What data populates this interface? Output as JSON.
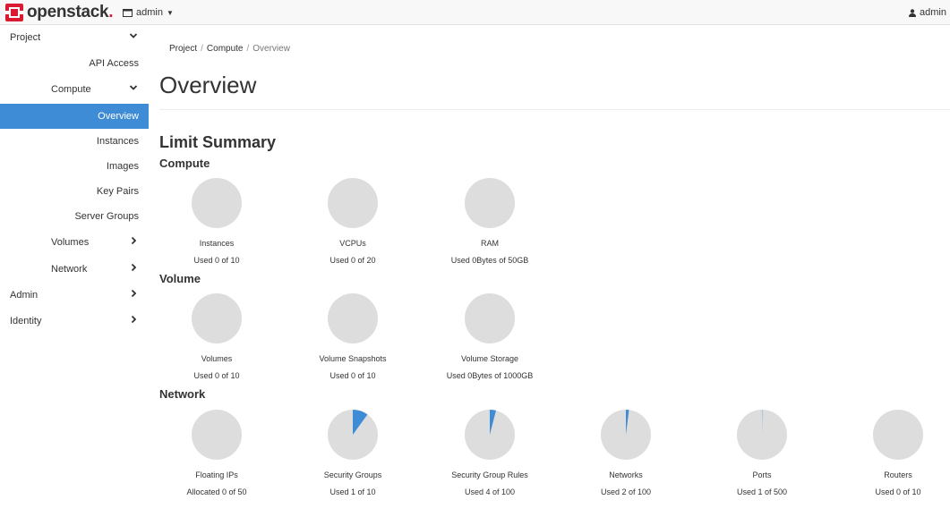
{
  "navbar": {
    "brand_name": "openstack",
    "brand_dot": ".",
    "project_label": "admin",
    "user_label": "admin",
    "icons": {
      "logo": "openstack-logo",
      "project": "project-icon",
      "user": "user-icon",
      "caret": "caret-down-icon"
    }
  },
  "sidebar": {
    "items": [
      {
        "label": "Project",
        "chevron": "down"
      },
      {
        "label": "API Access"
      },
      {
        "label": "Compute",
        "chevron": "down"
      },
      {
        "label": "Overview",
        "active": true
      },
      {
        "label": "Instances"
      },
      {
        "label": "Images"
      },
      {
        "label": "Key Pairs"
      },
      {
        "label": "Server Groups"
      },
      {
        "label": "Volumes",
        "chevron": "right"
      },
      {
        "label": "Network",
        "chevron": "right"
      },
      {
        "label": "Admin",
        "chevron": "right"
      },
      {
        "label": "Identity",
        "chevron": "right"
      }
    ]
  },
  "breadcrumb": {
    "items": [
      "Project",
      "Compute"
    ],
    "separator": "/",
    "current": "Overview"
  },
  "page": {
    "title": "Overview",
    "limit_summary": "Limit Summary"
  },
  "colors": {
    "pie_bg": "#dddddd",
    "pie_fill": "#3f8cd6",
    "active_bg": "#3f8cd6",
    "brand_red": "#da1a32"
  },
  "sections": [
    {
      "title": "Compute",
      "quotas": [
        {
          "label": "Instances",
          "used_text": "Used 0 of 10",
          "used": 0,
          "total": 10
        },
        {
          "label": "VCPUs",
          "used_text": "Used 0 of 20",
          "used": 0,
          "total": 20
        },
        {
          "label": "RAM",
          "used_text": "Used 0Bytes of 50GB",
          "used": 0,
          "total": 50
        }
      ]
    },
    {
      "title": "Volume",
      "quotas": [
        {
          "label": "Volumes",
          "used_text": "Used 0 of 10",
          "used": 0,
          "total": 10
        },
        {
          "label": "Volume Snapshots",
          "used_text": "Used 0 of 10",
          "used": 0,
          "total": 10
        },
        {
          "label": "Volume Storage",
          "used_text": "Used 0Bytes of 1000GB",
          "used": 0,
          "total": 1000
        }
      ]
    },
    {
      "title": "Network",
      "quotas": [
        {
          "label": "Floating IPs",
          "used_text": "Allocated 0 of 50",
          "used": 0,
          "total": 50
        },
        {
          "label": "Security Groups",
          "used_text": "Used 1 of 10",
          "used": 1,
          "total": 10
        },
        {
          "label": "Security Group Rules",
          "used_text": "Used 4 of 100",
          "used": 4,
          "total": 100
        },
        {
          "label": "Networks",
          "used_text": "Used 2 of 100",
          "used": 2,
          "total": 100
        },
        {
          "label": "Ports",
          "used_text": "Used 1 of 500",
          "used": 1,
          "total": 500
        },
        {
          "label": "Routers",
          "used_text": "Used 0 of 10",
          "used": 0,
          "total": 10
        }
      ]
    }
  ]
}
